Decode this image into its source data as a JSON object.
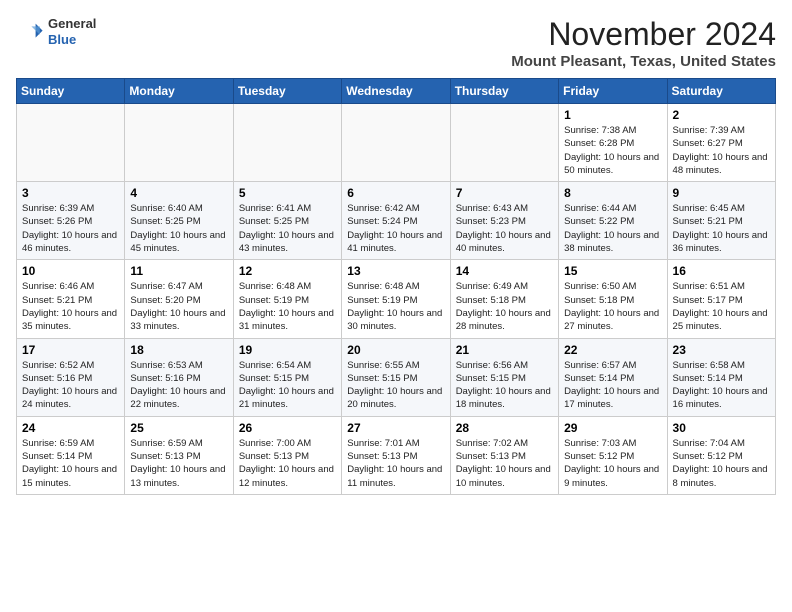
{
  "header": {
    "logo_line1": "General",
    "logo_line2": "Blue",
    "month": "November 2024",
    "location": "Mount Pleasant, Texas, United States"
  },
  "weekdays": [
    "Sunday",
    "Monday",
    "Tuesday",
    "Wednesday",
    "Thursday",
    "Friday",
    "Saturday"
  ],
  "weeks": [
    [
      {
        "day": "",
        "info": ""
      },
      {
        "day": "",
        "info": ""
      },
      {
        "day": "",
        "info": ""
      },
      {
        "day": "",
        "info": ""
      },
      {
        "day": "",
        "info": ""
      },
      {
        "day": "1",
        "info": "Sunrise: 7:38 AM\nSunset: 6:28 PM\nDaylight: 10 hours and 50 minutes."
      },
      {
        "day": "2",
        "info": "Sunrise: 7:39 AM\nSunset: 6:27 PM\nDaylight: 10 hours and 48 minutes."
      }
    ],
    [
      {
        "day": "3",
        "info": "Sunrise: 6:39 AM\nSunset: 5:26 PM\nDaylight: 10 hours and 46 minutes."
      },
      {
        "day": "4",
        "info": "Sunrise: 6:40 AM\nSunset: 5:25 PM\nDaylight: 10 hours and 45 minutes."
      },
      {
        "day": "5",
        "info": "Sunrise: 6:41 AM\nSunset: 5:25 PM\nDaylight: 10 hours and 43 minutes."
      },
      {
        "day": "6",
        "info": "Sunrise: 6:42 AM\nSunset: 5:24 PM\nDaylight: 10 hours and 41 minutes."
      },
      {
        "day": "7",
        "info": "Sunrise: 6:43 AM\nSunset: 5:23 PM\nDaylight: 10 hours and 40 minutes."
      },
      {
        "day": "8",
        "info": "Sunrise: 6:44 AM\nSunset: 5:22 PM\nDaylight: 10 hours and 38 minutes."
      },
      {
        "day": "9",
        "info": "Sunrise: 6:45 AM\nSunset: 5:21 PM\nDaylight: 10 hours and 36 minutes."
      }
    ],
    [
      {
        "day": "10",
        "info": "Sunrise: 6:46 AM\nSunset: 5:21 PM\nDaylight: 10 hours and 35 minutes."
      },
      {
        "day": "11",
        "info": "Sunrise: 6:47 AM\nSunset: 5:20 PM\nDaylight: 10 hours and 33 minutes."
      },
      {
        "day": "12",
        "info": "Sunrise: 6:48 AM\nSunset: 5:19 PM\nDaylight: 10 hours and 31 minutes."
      },
      {
        "day": "13",
        "info": "Sunrise: 6:48 AM\nSunset: 5:19 PM\nDaylight: 10 hours and 30 minutes."
      },
      {
        "day": "14",
        "info": "Sunrise: 6:49 AM\nSunset: 5:18 PM\nDaylight: 10 hours and 28 minutes."
      },
      {
        "day": "15",
        "info": "Sunrise: 6:50 AM\nSunset: 5:18 PM\nDaylight: 10 hours and 27 minutes."
      },
      {
        "day": "16",
        "info": "Sunrise: 6:51 AM\nSunset: 5:17 PM\nDaylight: 10 hours and 25 minutes."
      }
    ],
    [
      {
        "day": "17",
        "info": "Sunrise: 6:52 AM\nSunset: 5:16 PM\nDaylight: 10 hours and 24 minutes."
      },
      {
        "day": "18",
        "info": "Sunrise: 6:53 AM\nSunset: 5:16 PM\nDaylight: 10 hours and 22 minutes."
      },
      {
        "day": "19",
        "info": "Sunrise: 6:54 AM\nSunset: 5:15 PM\nDaylight: 10 hours and 21 minutes."
      },
      {
        "day": "20",
        "info": "Sunrise: 6:55 AM\nSunset: 5:15 PM\nDaylight: 10 hours and 20 minutes."
      },
      {
        "day": "21",
        "info": "Sunrise: 6:56 AM\nSunset: 5:15 PM\nDaylight: 10 hours and 18 minutes."
      },
      {
        "day": "22",
        "info": "Sunrise: 6:57 AM\nSunset: 5:14 PM\nDaylight: 10 hours and 17 minutes."
      },
      {
        "day": "23",
        "info": "Sunrise: 6:58 AM\nSunset: 5:14 PM\nDaylight: 10 hours and 16 minutes."
      }
    ],
    [
      {
        "day": "24",
        "info": "Sunrise: 6:59 AM\nSunset: 5:14 PM\nDaylight: 10 hours and 15 minutes."
      },
      {
        "day": "25",
        "info": "Sunrise: 6:59 AM\nSunset: 5:13 PM\nDaylight: 10 hours and 13 minutes."
      },
      {
        "day": "26",
        "info": "Sunrise: 7:00 AM\nSunset: 5:13 PM\nDaylight: 10 hours and 12 minutes."
      },
      {
        "day": "27",
        "info": "Sunrise: 7:01 AM\nSunset: 5:13 PM\nDaylight: 10 hours and 11 minutes."
      },
      {
        "day": "28",
        "info": "Sunrise: 7:02 AM\nSunset: 5:13 PM\nDaylight: 10 hours and 10 minutes."
      },
      {
        "day": "29",
        "info": "Sunrise: 7:03 AM\nSunset: 5:12 PM\nDaylight: 10 hours and 9 minutes."
      },
      {
        "day": "30",
        "info": "Sunrise: 7:04 AM\nSunset: 5:12 PM\nDaylight: 10 hours and 8 minutes."
      }
    ]
  ]
}
